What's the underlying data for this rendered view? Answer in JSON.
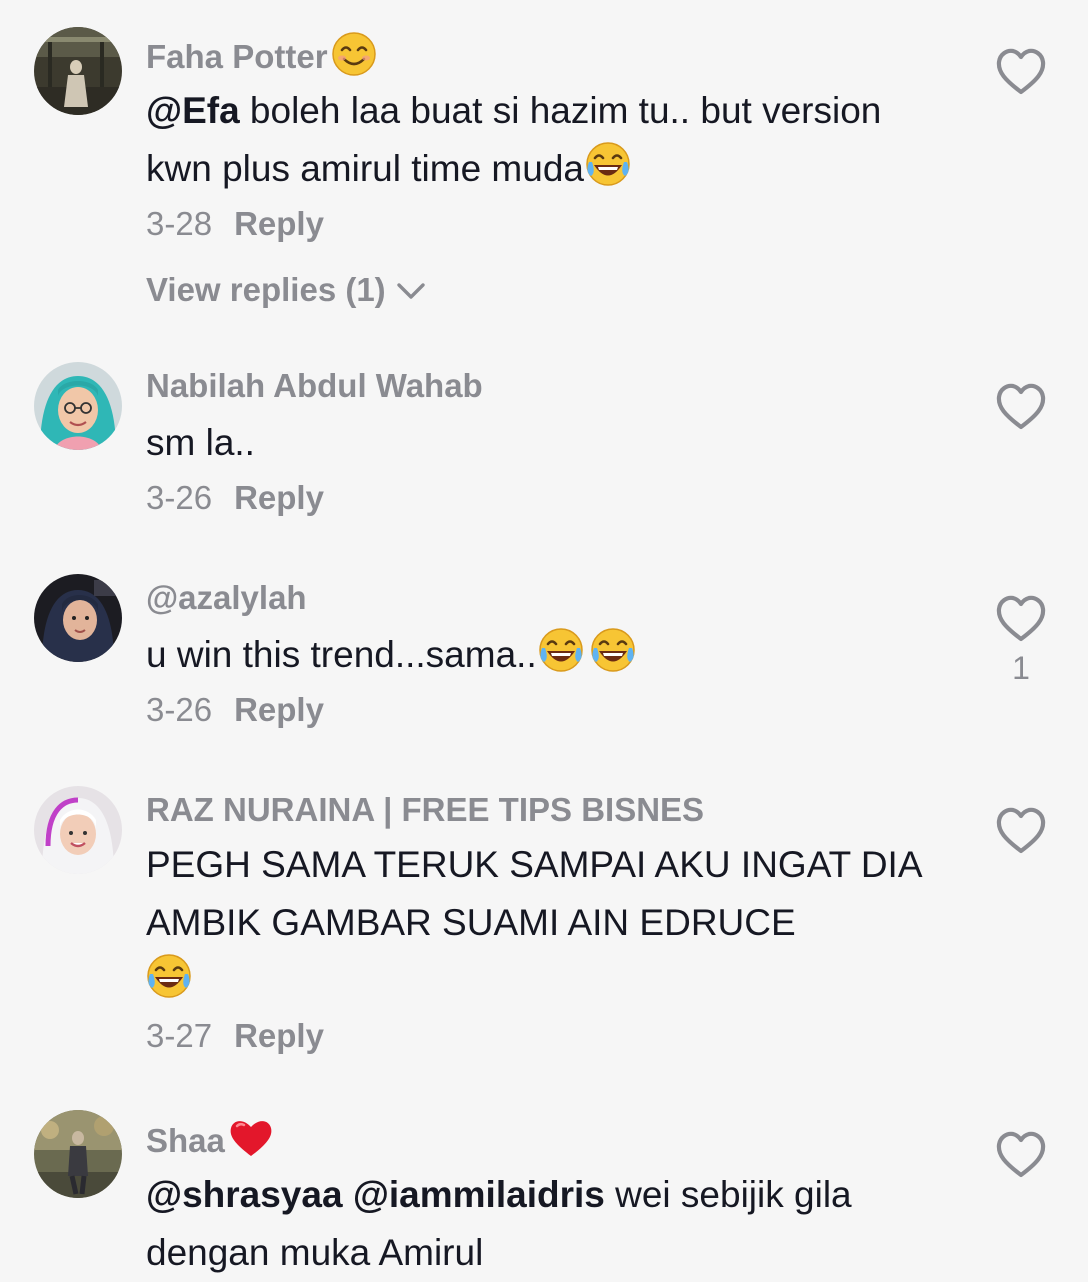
{
  "comments": [
    {
      "username": "Faha Potter",
      "username_emoji": "smiling-face-emoji",
      "mention": "@Efa",
      "text": " boleh laa buat si hazim tu.. but version kwn plus amirul time muda",
      "text_emoji": "tears-of-joy-emoji",
      "date": "3-28",
      "reply_label": "Reply",
      "view_replies": "View replies (1)",
      "likes": ""
    },
    {
      "username": "Nabilah Abdul Wahab",
      "text": "sm la..",
      "date": "3-26",
      "reply_label": "Reply",
      "likes": ""
    },
    {
      "username": "@azalylah",
      "text": "u win this trend...sama..",
      "text_emoji": "tears-of-joy-emoji x2",
      "date": "3-26",
      "reply_label": "Reply",
      "likes": "1"
    },
    {
      "username": "RAZ NURAINA | FREE TIPS BISNES",
      "text": "PEGH SAMA TERUK SAMPAI AKU INGAT DIA AMBIK GAMBAR SUAMI AIN EDRUCE",
      "text_emoji": "tears-of-joy-emoji",
      "date": "3-27",
      "reply_label": "Reply",
      "likes": ""
    },
    {
      "username": "Shaa",
      "username_emoji": "red-heart-emoji",
      "mention": "@shrasyaa @iammilaidris",
      "text": " wei sebijik gila dengan muka Amirul",
      "date": "",
      "reply_label": "",
      "likes": ""
    }
  ],
  "colors": {
    "background": "#f6f6f6",
    "text": "#161823",
    "secondary": "#8a8b91"
  },
  "icons": [
    "heart-outline-icon",
    "chevron-down-icon"
  ]
}
